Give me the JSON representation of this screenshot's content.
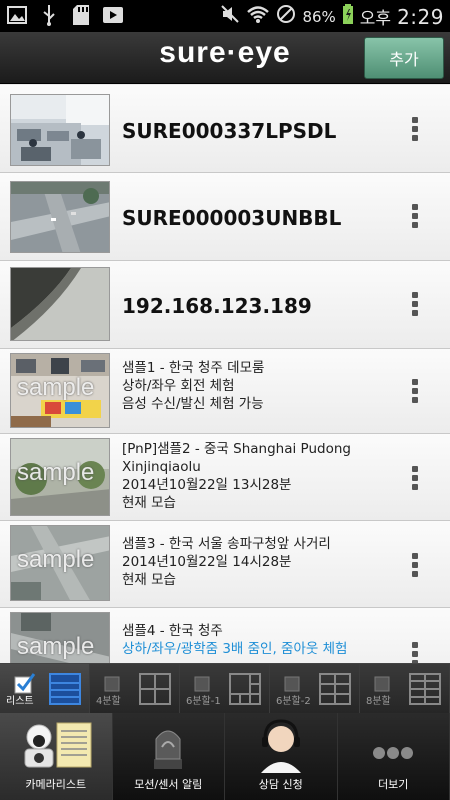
{
  "status_bar": {
    "battery_percent": "86%",
    "ampm": "오후",
    "time": "2:29",
    "icons": [
      "image-icon",
      "usb-icon",
      "sd-card-icon",
      "play-icon",
      "mute-icon",
      "wifi-icon",
      "no-signal-icon",
      "battery-icon"
    ]
  },
  "header": {
    "logo": "sure·eye",
    "add_label": "추가"
  },
  "cameras": [
    {
      "title": "SURE000337LPSDL",
      "lines": []
    },
    {
      "title": "SURE000003UNBBL",
      "lines": []
    },
    {
      "title": "192.168.123.189",
      "lines": []
    },
    {
      "title": "",
      "sample": "sample",
      "lines": [
        "샘플1 - 한국 청주 데모룸",
        "상하/좌우 회전 체험",
        "음성 수신/발신 체험 가능"
      ]
    },
    {
      "title": "",
      "sample": "sample",
      "lines": [
        "[PnP]샘플2 - 중국 Shanghai Pudong",
        "Xinjinqiaolu",
        "2014년10월22일  13시28분",
        "현재 모습"
      ]
    },
    {
      "title": "",
      "sample": "sample",
      "lines": [
        "샘플3 - 한국 서울 송파구청앞 사거리",
        "2014년10월22일  14시28분",
        "현재 모습"
      ]
    },
    {
      "title": "",
      "sample": "sample",
      "lines": [
        "샘플4 - 한국 청주"
      ],
      "highlight": "상하/좌우/광학줌 3배 줌인, 줌아웃 체험"
    }
  ],
  "split_views": [
    "리스트",
    "4분할",
    "6분할-1",
    "6분할-2",
    "8분할"
  ],
  "tabs": [
    "카메라리스트",
    "모션/센서 알림",
    "상담 신청",
    "더보기"
  ],
  "colors": {
    "accent_green": "#5f9f83",
    "link_blue": "#1f8fd6"
  }
}
